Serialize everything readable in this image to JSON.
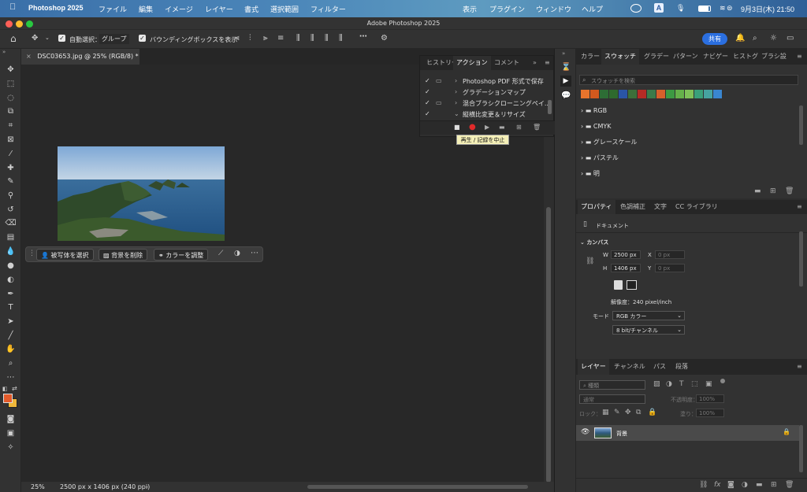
{
  "menubar": {
    "app_name": "Photoshop 2025",
    "items": [
      "ファイル",
      "編集",
      "イメージ",
      "レイヤー",
      "書式",
      "選択範囲",
      "フィルター"
    ],
    "right_items": [
      "表示",
      "プラグイン",
      "ウィンドウ",
      "ヘルプ"
    ],
    "input_indicator": "A",
    "datetime": "9月3日(木) 21:50"
  },
  "window": {
    "title": "Adobe Photoshop 2025"
  },
  "options": {
    "auto_select_label": "自動選択：",
    "auto_select_value": "グループ",
    "bbox_label": "バウンディングボックスを表示",
    "share_label": "共有"
  },
  "document": {
    "tab_title": "DSC03653.jpg @ 25% (RGB/8) *"
  },
  "context_bar": {
    "select_subject": "被写体を選択",
    "remove_bg": "背景を削除",
    "adjust_color": "カラーを調整"
  },
  "actions_panel": {
    "tabs": [
      "ヒストリー",
      "アクション",
      "コメント"
    ],
    "active_tab": "アクション",
    "rows": [
      "Photoshop PDF 形式で保存",
      "グラデーションマップ",
      "混合ブラシクローニングペイ...",
      "縦横比変更＆リサイズ"
    ],
    "tooltip": "再生 / 記録を中止"
  },
  "swatches_panel": {
    "tabs": [
      "カラー",
      "スウォッチ",
      "グラデー",
      "パターン",
      "ナビゲー",
      "ヒストグ",
      "ブラシ設"
    ],
    "active_tab": "スウォッチ",
    "search_placeholder": "スウォッチを検索",
    "colors": [
      "#e8742c",
      "#d2591e",
      "#2d6d35",
      "#2e6a2d",
      "#2a55a6",
      "#3d6f3a",
      "#b52b25",
      "#3b7a4a",
      "#d5602b",
      "#3c9a42",
      "#65b14a",
      "#7fc159",
      "#3aa07a",
      "#46a3a0",
      "#3a86d0"
    ],
    "groups": [
      "RGB",
      "CMYK",
      "グレースケール",
      "パステル",
      "明"
    ]
  },
  "properties_panel": {
    "tabs": [
      "プロパティ",
      "色調補正",
      "文字",
      "CC ライブラリ"
    ],
    "active_tab": "プロパティ",
    "doc_label": "ドキュメント",
    "canvas_label": "カンバス",
    "width_label": "W",
    "width_value": "2500 px",
    "height_label": "H",
    "height_value": "1406 px",
    "x_label": "X",
    "x_placeholder": "0 px",
    "y_label": "Y",
    "y_placeholder": "0 px",
    "resolution": "解像度：240 pixel/inch",
    "mode_label": "モード",
    "mode_value": "RGB カラー",
    "bits_value": "8 bit/チャンネル"
  },
  "layers_panel": {
    "tabs": [
      "レイヤー",
      "チャンネル",
      "パス",
      "段落"
    ],
    "active_tab": "レイヤー",
    "filter_placeholder": "種類",
    "blend_mode": "通常",
    "opacity_label": "不透明度：",
    "opacity_value": "100%",
    "lock_label": "ロック：",
    "fill_label": "塗り：",
    "fill_value": "100%",
    "layer_name": "背景"
  },
  "status": {
    "zoom": "25%",
    "doc_info": "2500 px x 1406 px (240 ppi)"
  }
}
